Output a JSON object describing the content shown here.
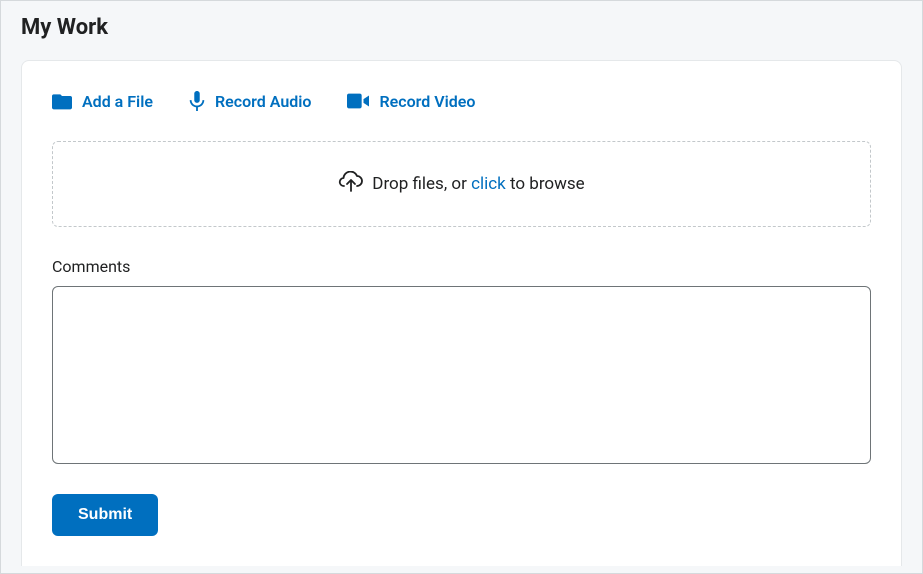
{
  "page": {
    "title": "My Work"
  },
  "actions": {
    "add_file": "Add a File",
    "record_audio": "Record Audio",
    "record_video": "Record Video"
  },
  "dropzone": {
    "prefix": "Drop files, or ",
    "click": "click",
    "suffix": " to browse"
  },
  "comments": {
    "label": "Comments",
    "value": ""
  },
  "buttons": {
    "submit": "Submit"
  }
}
